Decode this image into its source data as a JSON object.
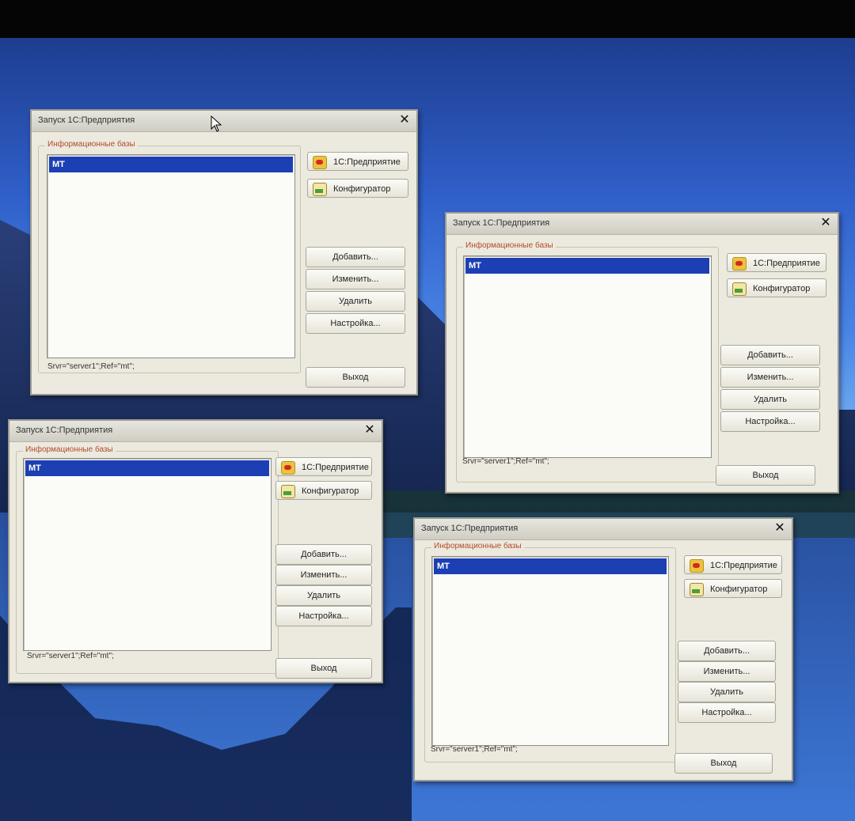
{
  "dialogs": [
    {
      "title": "Запуск 1С:Предприятия",
      "group_label": "Информационные базы",
      "selected_item": "MT",
      "buttons": {
        "enterprise": "1С:Предприятие",
        "configurator": "Конфигуратор",
        "add": "Добавить...",
        "edit": "Изменить...",
        "delete": "Удалить",
        "settings": "Настройка...",
        "exit": "Выход"
      },
      "status": "Srvr=\"server1\";Ref=\"mt\";"
    },
    {
      "title": "Запуск 1С:Предприятия",
      "group_label": "Информационные базы",
      "selected_item": "MT",
      "buttons": {
        "enterprise": "1С:Предприятие",
        "configurator": "Конфигуратор",
        "add": "Добавить...",
        "edit": "Изменить...",
        "delete": "Удалить",
        "settings": "Настройка...",
        "exit": "Выход"
      },
      "status": "Srvr=\"server1\";Ref=\"mt\";"
    },
    {
      "title": "Запуск 1С:Предприятия",
      "group_label": "Информационные базы",
      "selected_item": "MT",
      "buttons": {
        "enterprise": "1С:Предприятие",
        "configurator": "Конфигуратор",
        "add": "Добавить...",
        "edit": "Изменить...",
        "delete": "Удалить",
        "settings": "Настройка...",
        "exit": "Выход"
      },
      "status": "Srvr=\"server1\";Ref=\"mt\";"
    },
    {
      "title": "Запуск 1С:Предприятия",
      "group_label": "Информационные базы",
      "selected_item": "MT",
      "buttons": {
        "enterprise": "1С:Предприятие",
        "configurator": "Конфигуратор",
        "add": "Добавить...",
        "edit": "Изменить...",
        "delete": "Удалить",
        "settings": "Настройка...",
        "exit": "Выход"
      },
      "status": "Srvr=\"server1\";Ref=\"mt\";"
    }
  ],
  "icons": {
    "close": "close-icon",
    "enterprise": "1c-enterprise-icon",
    "configurator": "configurator-icon",
    "cursor": "mouse-cursor-icon"
  }
}
